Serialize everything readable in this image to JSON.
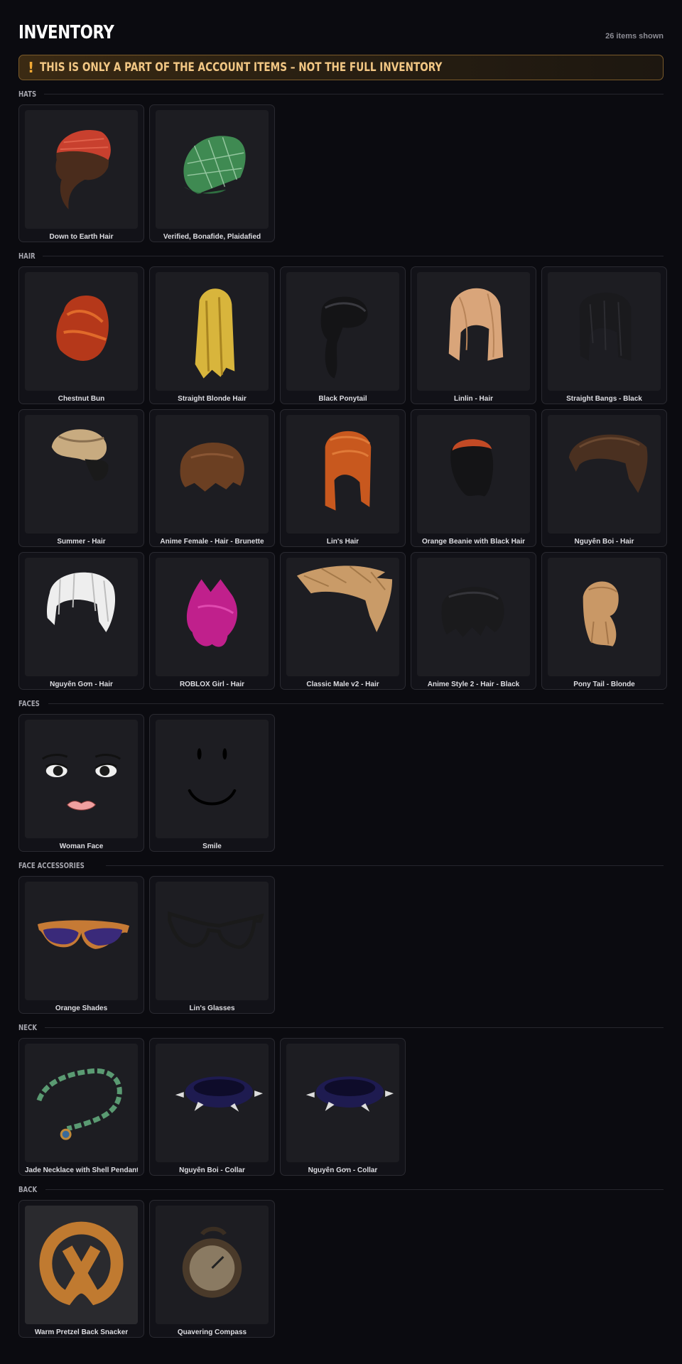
{
  "header": {
    "title": "INVENTORY",
    "count": "26 items shown"
  },
  "banner": {
    "icon": "!",
    "text": "THIS IS ONLY A PART OF THE ACCOUNT ITEMS – NOT THE FULL INVENTORY"
  },
  "sections": [
    {
      "name": "HATS",
      "items": [
        "Down to Earth Hair",
        "Verified, Bonafide, Plaidafied"
      ]
    },
    {
      "name": "HAIR",
      "items": [
        "Chestnut Bun",
        "Straight Blonde Hair",
        "Black Ponytail",
        "Linlin - Hair",
        "Straight Bangs - Black",
        "Summer - Hair",
        "Anime Female - Hair - Brunette",
        "Lin's Hair",
        "Orange Beanie with Black Hair",
        "Nguyễn Boi - Hair",
        "Nguyễn Gơn - Hair",
        "ROBLOX Girl - Hair",
        "Classic Male v2 - Hair",
        "Anime Style 2 - Hair - Black",
        "Pony Tail - Blonde"
      ]
    },
    {
      "name": "FACES",
      "items": [
        "Woman Face",
        "Smile"
      ]
    },
    {
      "name": "FACE ACCESSORIES",
      "items": [
        "Orange Shades",
        "Lin's Glasses"
      ]
    },
    {
      "name": "NECK",
      "items": [
        "Jade Necklace with Shell Pendant",
        "Nguyễn Boi - Collar",
        "Nguyễn Gơn - Collar"
      ]
    },
    {
      "name": "BACK",
      "items": [
        "Warm Pretzel Back Snacker",
        "Quavering Compass"
      ]
    }
  ],
  "colors": {
    "banner_accent": "#f1a935",
    "banner_text": "#f2c784",
    "background": "#0b0b10"
  }
}
